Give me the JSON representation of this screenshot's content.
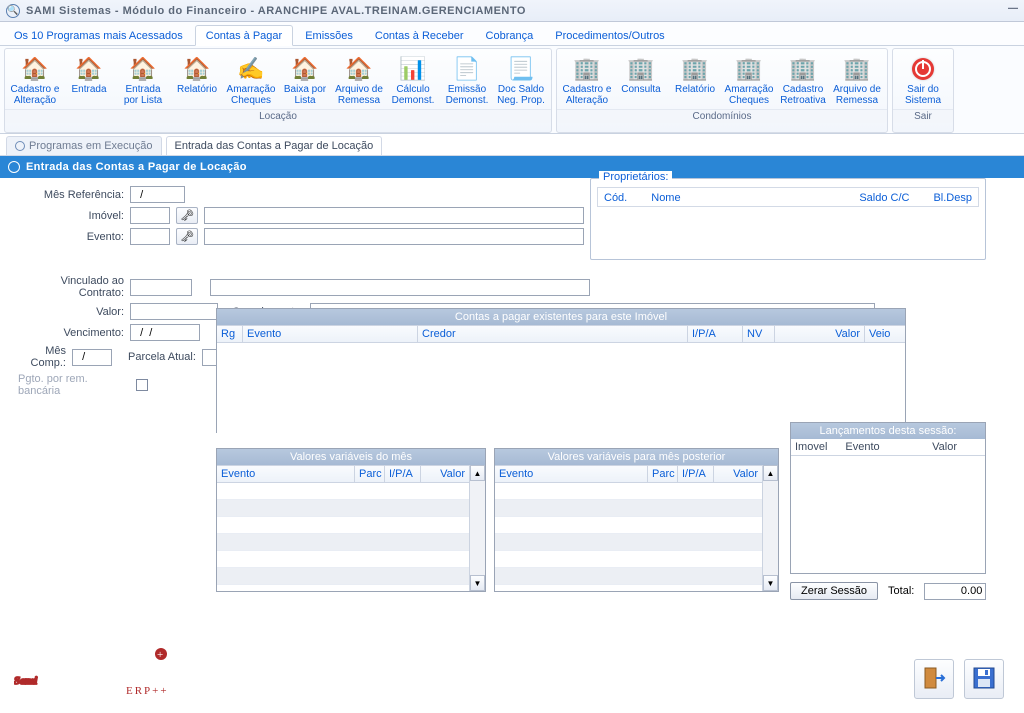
{
  "window": {
    "title": "SAMI Sistemas - Módulo do Financeiro - ARANCHIPE AVAL.TREINAM.GERENCIAMENTO"
  },
  "tabs": {
    "items": [
      {
        "label": "Os 10 Programas mais Acessados"
      },
      {
        "label": "Contas à Pagar"
      },
      {
        "label": "Emissões"
      },
      {
        "label": "Contas à Receber"
      },
      {
        "label": "Cobrança"
      },
      {
        "label": "Procedimentos/Outros"
      }
    ],
    "active": 1
  },
  "ribbon": {
    "groups": [
      {
        "label": "Locação",
        "buttons": [
          {
            "label": "Cadastro e Alteração",
            "icon": "house-edit-icon"
          },
          {
            "label": "Entrada",
            "icon": "house-arrow-icon"
          },
          {
            "label": "Entrada por Lista",
            "icon": "house-list-icon"
          },
          {
            "label": "Relatório",
            "icon": "house-report-icon"
          },
          {
            "label": "Amarração Cheques",
            "icon": "cheque-icon"
          },
          {
            "label": "Baixa por Lista",
            "icon": "house-down-icon"
          },
          {
            "label": "Arquivo de Remessa",
            "icon": "house-file-icon"
          },
          {
            "label": "Cálculo Demonst.",
            "icon": "calc-icon"
          },
          {
            "label": "Emissão Demonst.",
            "icon": "emit-icon"
          },
          {
            "label": "Doc Saldo Neg. Prop.",
            "icon": "doc-saldo-icon"
          }
        ]
      },
      {
        "label": "Condomínios",
        "buttons": [
          {
            "label": "Cadastro e Alteração",
            "icon": "building-edit-icon"
          },
          {
            "label": "Consulta",
            "icon": "building-search-icon"
          },
          {
            "label": "Relatório",
            "icon": "building-report-icon"
          },
          {
            "label": "Amarração Cheques",
            "icon": "building-cheque-icon"
          },
          {
            "label": "Cadastro Retroativa",
            "icon": "building-retro-icon"
          },
          {
            "label": "Arquivo de Remessa",
            "icon": "building-file-icon"
          }
        ]
      },
      {
        "label": "Sair",
        "buttons": [
          {
            "label": "Sair do Sistema",
            "icon": "power-icon"
          }
        ]
      }
    ]
  },
  "subtabs": {
    "items": [
      {
        "label": "Programas em Execução"
      },
      {
        "label": "Entrada das Contas a Pagar de Locação"
      }
    ],
    "active": 1
  },
  "page": {
    "header": "Entrada das Contas a Pagar de Locação",
    "fields": {
      "mes_ref_label": "Mês Referência:",
      "mes_ref_value": "  /",
      "imovel_label": "Imóvel:",
      "evento_label": "Evento:",
      "vinc_label": "Vinculado ao Contrato:",
      "valor_label": "Valor:",
      "compl_label": "Complemento:",
      "venc_label": "Vencimento:",
      "venc_value": "  /  /",
      "mes_comp_label": "Mês Comp.:",
      "mes_comp_value": "  /",
      "parcela_label": "Parcela Atual:",
      "pgto_label": "Pgto. por rem. bancária"
    },
    "prop_box": {
      "legend": "Proprietários:",
      "cols": {
        "c1": "Cód.",
        "c2": "Nome",
        "c3": "Saldo C/C",
        "c4": "Bl.Desp"
      }
    },
    "tables": {
      "existentes": {
        "title": "Contas a pagar existentes para este Imóvel",
        "cols": {
          "rg": "Rg",
          "evento": "Evento",
          "credor": "Credor",
          "ipa": "I/P/A",
          "nv": "NV",
          "valor": "Valor",
          "veio": "Veio"
        }
      },
      "var_mes": {
        "title": "Valores variáveis do mês",
        "cols": {
          "evento": "Evento",
          "parc": "Parc",
          "ipa": "I/P/A",
          "valor": "Valor"
        }
      },
      "var_post": {
        "title": "Valores variáveis para mês posterior",
        "cols": {
          "evento": "Evento",
          "parc": "Parc",
          "ipa": "I/P/A",
          "valor": "Valor"
        }
      },
      "sessao": {
        "title": "Lançamentos desta sessão:",
        "cols": {
          "imovel": "Imovel",
          "evento": "Evento",
          "valor": "Valor"
        }
      }
    },
    "buttons": {
      "zerar": "Zerar Sessão",
      "total_label": "Total:",
      "total_value": "0.00"
    }
  }
}
